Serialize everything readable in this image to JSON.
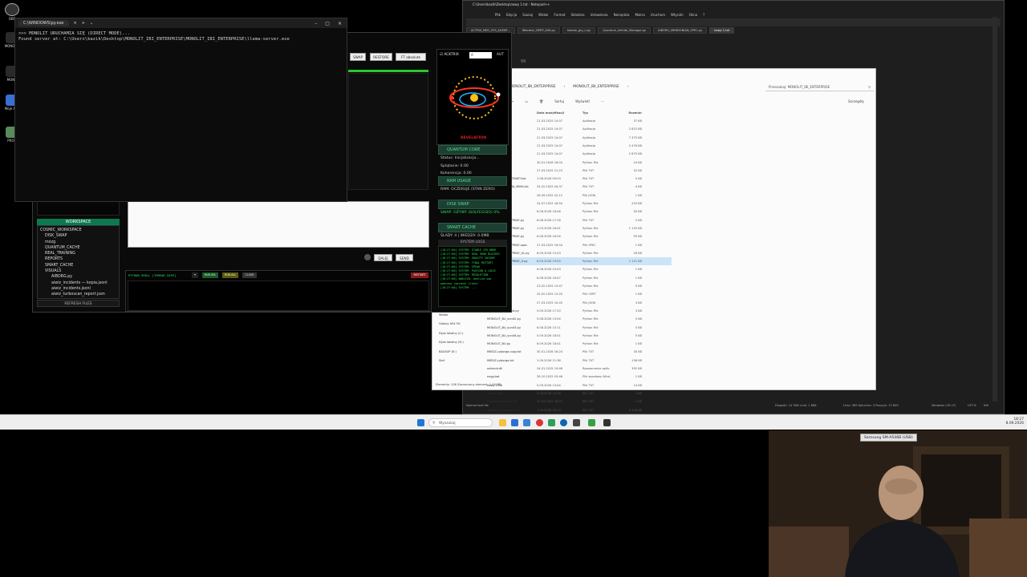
{
  "desktop": {
    "icons": [
      {
        "label": "OBS"
      },
      {
        "label": "MONOLIT"
      },
      {
        "label": "MONO"
      },
      {
        "label": "Moje App"
      },
      {
        "label": "PROG"
      }
    ]
  },
  "cmd": {
    "title": "C:\\WINDOWS\\py.exe",
    "lines": [
      ">>> MONOLIT URUCHAMIA SIĘ (DIRECT MODE)...",
      "Found server at: C:\\Users\\kazik\\Desktop\\MONOLIT_IBI_ENTERPRISE\\MONOLIT_IBI_ENTERPRISE\\llama-server.exe"
    ]
  },
  "app": {
    "toolbar": {
      "swap": "SWAP",
      "restore": "RESTORE",
      "absolute": "FT absolute"
    },
    "acktrix": {
      "label": "ACKTRIX",
      "value": "A",
      "aut": "AUT"
    },
    "revelation": "REVELATION",
    "quantum": {
      "header": "QUANTUM CORE",
      "status": "Status: Inicjalizacja...",
      "splatanie": "Splątanie: 0.00",
      "koherencja": "Koherencja: 0.00"
    },
    "ram": {
      "header": "RAM USAGE",
      "value": "RAM: OCZEKUJE (STAN ZERO)"
    },
    "disk": {
      "header": "DISK SWAP",
      "value": "SWAP: OŻYWY (SOLFEGGIO) 0%"
    },
    "cache": {
      "header": "SMART CACHE",
      "value": "ŚLADY: 4 | WIEDZA: 0.0MB"
    },
    "syslog_header": "SYSTEM LOGS",
    "syslog": [
      "[18:27:00] SYSTEM: STABLE CPU MODE",
      "[18:27:00] SYSTEM: REAL GROK BLOCKED",
      "[18:27:00] SYSTEM: GRAVITY VACUUM",
      "[18:27:00] SYSTEM: FINAL RESTART",
      "[18:27:00] SYSTEM: SPEAK",
      "[18:27:00] SYSTEM: PASSION & LOGIC",
      "[18:27:00] SYSTEM: RESOLUTION",
      "[18:27:00] ANALIZA: Analiza swo",
      "pobrana (ograne) ilości",
      "[18:27:00] SYSTEM: ..."
    ],
    "workspace": "WORKSPACE",
    "tree": [
      "COSMIC_WORKSPACE",
      "DISK_SWAP",
      "mózg",
      "QUANTUM_CACHE",
      "REAL_TRAINING",
      "REPORTS",
      "SMART_CACHE",
      "VISUALS",
      "AIBORG.py",
      "aiwiz_incidents — kopia.jsonl",
      "aiwiz_incidents.jsonl",
      "aiwiz_turboscan_report.json"
    ],
    "refresh": "REFRESH FILES",
    "send": {
      "dalej": "DALEJ",
      "send": "SEND"
    },
    "shell": {
      "label": "PYTHON SHELL [THREAD SAFE]",
      "run_sel": "RUN SEL",
      "run_all": "RUN ALL",
      "clear": "CLEAR",
      "restart": "RESTART"
    }
  },
  "notepad": {
    "title": "C:\\Users\\kazik\\Desktop\\nowy 1.txt - Notepad++",
    "menu": [
      "Plik",
      "Edycja",
      "Szukaj",
      "Widok",
      "Format",
      "Składnia",
      "Ustawienia",
      "Narzędzia",
      "Makra",
      "Uruchom",
      "Wtyczki",
      "Okna",
      "?"
    ],
    "tabs": [
      "ACTRIX_MED_SYS_AGENT...",
      "Wibrator_DEEP_AIXI.py",
      "testow_gry_n.py",
      "Quantum_Infinite_Manager.py",
      "AIBORG_MENDONIAN_SPEC.py",
      "nowy 1.txt"
    ],
    "line": "99",
    "status": {
      "normal": "Normal text file",
      "length": "Długość: 14 958   Linie: 1 868",
      "pos": "Linia: 389   Kolumna: 3   Pozycja: 13 849",
      "eol": "Windows (CR LF)",
      "enc": "UTF-8",
      "ins": "INS"
    }
  },
  "explorer": {
    "breadcrumb": [
      "MONOLIT_IBI_ENTERPRISE",
      "MONOLIT_IBI_ENTERPRISE"
    ],
    "search": "Przeszukaj: MONOLIT_IBI_ENTERPRISE",
    "toolbar": {
      "sort": "Sortuj",
      "view": "Wyświetl",
      "details": "Szczegóły"
    },
    "headers": {
      "name": "Nazwa",
      "date": "Data modyfikacji",
      "type": "Typ",
      "size": "Rozmiar"
    },
    "rows": [
      {
        "n": "llama-cli.exe",
        "d": "21.03.2025 14:07",
        "t": "Aplikacja",
        "s": "37 KB"
      },
      {
        "n": "llama-server.exe",
        "d": "21.03.2025 14:07",
        "t": "Aplikacja",
        "s": "2 815 KB"
      },
      {
        "n": "llama.exe",
        "d": "21.03.2025 14:07",
        "t": "Aplikacja",
        "s": "7 375 KB"
      },
      {
        "n": "llama-run.exe",
        "d": "21.03.2025 14:07",
        "t": "Aplikacja",
        "s": "2 476 KB"
      },
      {
        "n": "llava-cli.exe",
        "d": "21.03.2025 14:07",
        "t": "Aplikacja",
        "s": "2 675 KB"
      },
      {
        "n": "main.py",
        "d": "30.01.2026 18:04",
        "t": "Python File",
        "s": "24 KB"
      },
      {
        "n": "MON.py",
        "d": "27.03.2025 21:23",
        "t": "Plik TXT",
        "s": "32 KB"
      },
      {
        "n": "MONOLIT_IBI_INSTINKTY.txt",
        "d": "1.08.2026 09:53",
        "t": "Plik TXT",
        "s": "5 KB"
      },
      {
        "n": "MONOLIT_MAXYMA_MIMA.txt",
        "d": "24.02.2025 04:37",
        "t": "Plik TXT",
        "s": "4 KB"
      },
      {
        "n": "monolit.json",
        "d": "28.09.2025 22:12",
        "t": "Plik JSON",
        "s": "1 KB"
      },
      {
        "n": "MONO.py",
        "d": "24.07.2025 18:50",
        "t": "Python File",
        "s": "293 KB"
      },
      {
        "n": "monolit_MON.py",
        "d": "6.08.2026 16:46",
        "t": "Python File",
        "s": "30 KB"
      },
      {
        "n": "MONOLIT_ENTERPRISE.py",
        "d": "8.08.2026 17:18",
        "t": "Plik TXT",
        "s": "2 KB"
      },
      {
        "n": "MONOLIT_ENTERPRISE.py",
        "d": "1.03.2026 16:01",
        "t": "Python File",
        "s": "1 155 KB"
      },
      {
        "n": "MONOLIT_ENTERPRISE.py",
        "d": "6.08.2026 16:54",
        "t": "Python File",
        "s": "95 KB"
      },
      {
        "n": "MONOLIT_ENTERPRISE.spec",
        "d": "27.03.2025 16:54",
        "t": "Plik SPEC",
        "s": "1 KB"
      },
      {
        "n": "MONOLIT_ENTERPRISE_UL.py",
        "d": "6.09.2026 15:43",
        "t": "Python File",
        "s": "26 KB"
      },
      {
        "n": "MONOLIT_ENTERPRISE_X.py",
        "d": "6.09.2026 19:50",
        "t": "Python File",
        "s": "1 121 KB"
      },
      {
        "n": "MONOLIT_10.py",
        "d": "6.08.2026 20:43",
        "t": "Python File",
        "s": "1 KB"
      },
      {
        "n": "MONOLIT_99.py",
        "d": "6.08.2026 18:47",
        "t": "Python File",
        "s": "1 KB"
      },
      {
        "n": "MONOLIT_FIN.py",
        "d": "23.02.2025 13:47",
        "t": "Python File",
        "s": "9 KB"
      },
      {
        "n": "MONOLIT_BU.dll",
        "d": "25.02.2025 13:20",
        "t": "Plik CERT",
        "s": "1 KB"
      },
      {
        "n": "MONOLIT_BU.xpy",
        "d": "27.03.2025 10:45",
        "t": "Plik JSON",
        "s": "3 KB"
      },
      {
        "n": "MONOLIT_BU_sunit.py",
        "d": "5.09.2026 17:20",
        "t": "Python File",
        "s": "3 KB"
      },
      {
        "n": "MONOLIT_BU_sunit2.py",
        "d": "5.08.2026 13:04",
        "t": "Python File",
        "s": "5 KB"
      },
      {
        "n": "MONOLIT_BU_sunit3.py",
        "d": "6.08.2026 13:11",
        "t": "Python File",
        "s": "5 KB"
      },
      {
        "n": "MONOLIT_BU_sunit4.py",
        "d": "5.09.2026 18:51",
        "t": "Python File",
        "s": "5 KB"
      },
      {
        "n": "MONOLIT_BU.py",
        "d": "6.09.2026 18:41",
        "t": "Python File",
        "s": "1 KB"
      },
      {
        "n": "MIEDZ-cyborga.copy.txt",
        "d": "30.01.2026 16:24",
        "t": "Plik TXT",
        "s": "30 KB"
      },
      {
        "n": "MIEDZ-cyborga.txt",
        "d": "1.09.2026 11:36",
        "t": "Plik TXT",
        "s": "136 KB"
      },
      {
        "n": "odrendr.dll",
        "d": "24.01.2025 19:46",
        "t": "Rozszerzenie aplik.",
        "s": "392 KB"
      },
      {
        "n": "nagy.bat",
        "d": "28.10.2025 03:46",
        "t": "Plik wsadowy Wind.",
        "s": "1 KB"
      },
      {
        "n": "nowy 1.txt",
        "d": "5.09.2026 13:44",
        "t": "Plik TXT",
        "s": "14 KB"
      },
      {
        "n": "nowy 1.txt",
        "d": "5.08.2026 13:36",
        "t": "Plik TXT",
        "s": "3 KB"
      },
      {
        "n": "odpowiedz_mono.txt",
        "d": "27.03.2025 16:47",
        "t": "Plik TXT",
        "s": "1 KB"
      },
      {
        "n": "odpowiedz_mono2.txt",
        "d": "1.09.2026 16:23",
        "t": "Plik TXT",
        "s": "6 108 KB"
      }
    ],
    "left": [
      "Dokumenty",
      "Obrazy",
      "Muzyka",
      "Wideo",
      "Galaxy A54 5G",
      "Dysk lokalny (C:)",
      "Dysk lokalny (D:)",
      "BACKUP (E:)",
      "Sieć"
    ],
    "status": "Elementy: 106   Zaznaczony element: 1,10 MB"
  },
  "taskbar": {
    "search": "Wyszukaj",
    "time": "18:27",
    "date": "8.09.2026"
  },
  "webcam": {
    "label": "Samsung SM-A546B (USB)"
  }
}
